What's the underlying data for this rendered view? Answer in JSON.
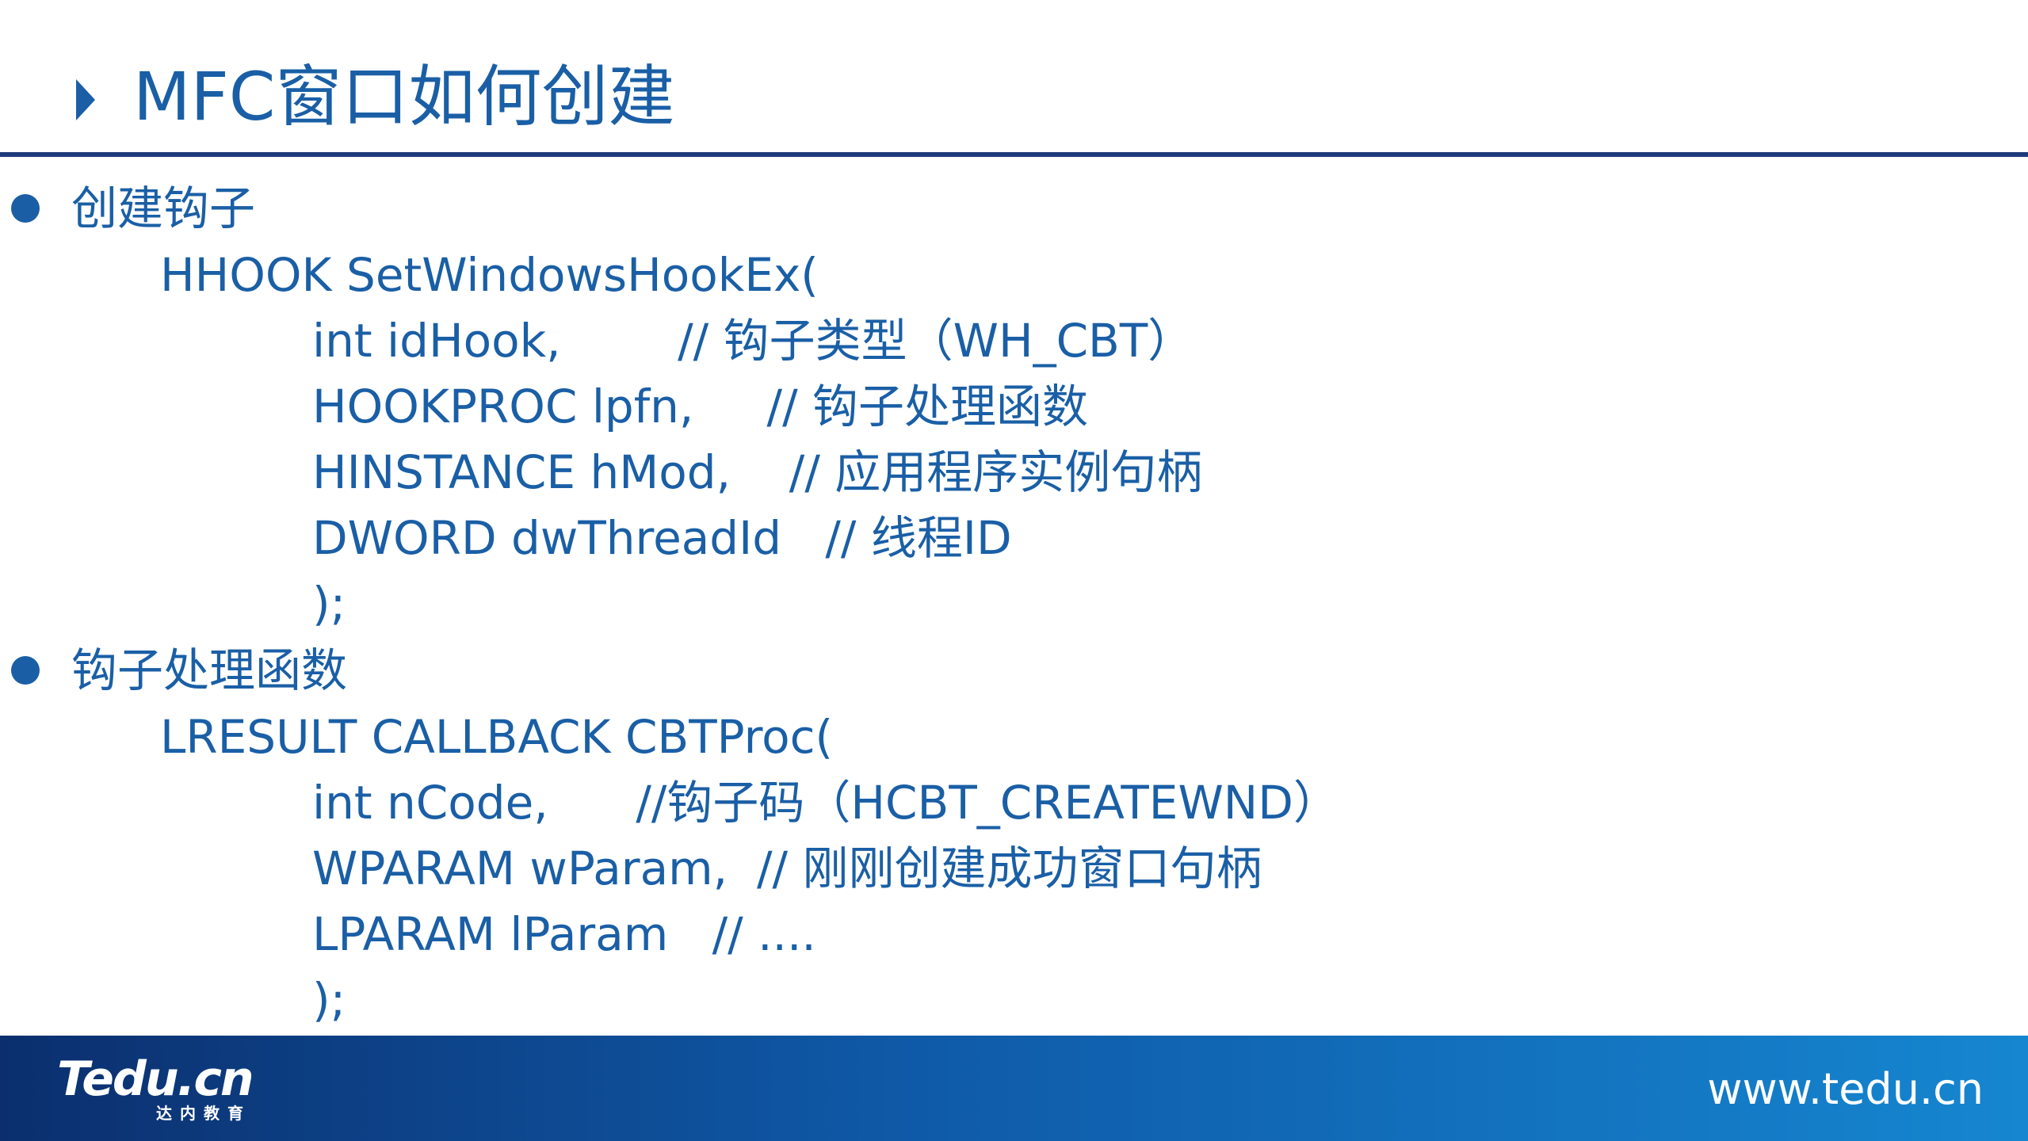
{
  "slide": {
    "title": "MFC窗口如何创建",
    "sections": [
      {
        "heading": "创建钩子",
        "lines": [
          "HHOOK SetWindowsHookEx(",
          "int idHook,        // 钩子类型（WH_CBT）",
          "HOOKPROC lpfn,     // 钩子处理函数",
          "HINSTANCE hMod,    // 应用程序实例句柄",
          "DWORD dwThreadId   // 线程ID",
          ");"
        ]
      },
      {
        "heading": "钩子处理函数",
        "lines": [
          "LRESULT CALLBACK CBTProc(",
          "int nCode,      //钩子码（HCBT_CREATEWND）",
          "WPARAM wParam,  // 刚刚创建成功窗口句柄",
          "LPARAM lParam   // ....",
          ");"
        ]
      }
    ]
  },
  "footer": {
    "logo_main": "Tedu.cn",
    "logo_sub": "达内教育",
    "website": "www.tedu.cn"
  },
  "colors": {
    "text": "#1a5fa6",
    "rule": "#1f3a7a",
    "footer_start": "#0b2f6e",
    "footer_end": "#1686d0"
  },
  "icons": {
    "title_marker": "triangle-right-icon",
    "bullet": "bullet-dot-icon"
  }
}
